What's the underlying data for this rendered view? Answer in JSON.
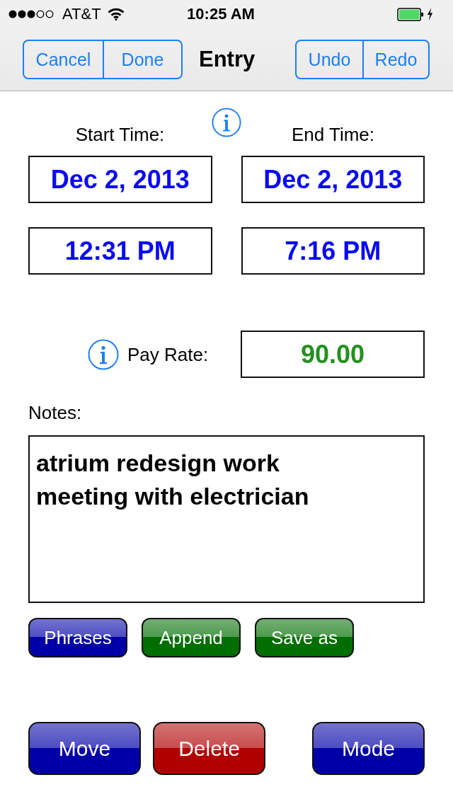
{
  "status_bar": {
    "carrier": "AT&T",
    "time": "10:25 AM"
  },
  "nav_bar": {
    "left_buttons": [
      "Cancel",
      "Done"
    ],
    "title": "Entry",
    "right_buttons": [
      "Undo",
      "Redo"
    ]
  },
  "time_columns": [
    {
      "label": "Start Time:",
      "date": "Dec 2, 2013",
      "time": "12:31 PM"
    },
    {
      "label": "End Time:",
      "date": "Dec 2, 2013",
      "time": "7:16 PM"
    }
  ],
  "pay_rate": {
    "label": "Pay Rate:",
    "value": "90.00"
  },
  "notes": {
    "label": "Notes:",
    "value": "atrium redesign work\nmeeting with electrician"
  },
  "note_buttons": [
    {
      "label": "Phrases",
      "color": "#0000a8"
    },
    {
      "label": "Append",
      "color": "#006e00"
    },
    {
      "label": "Save as",
      "color": "#006e00"
    }
  ],
  "action_buttons": [
    {
      "label": "Move",
      "color": "#0000a8"
    },
    {
      "label": "Delete",
      "color": "#b00000"
    },
    {
      "label": "Mode",
      "color": "#0000a8"
    }
  ]
}
